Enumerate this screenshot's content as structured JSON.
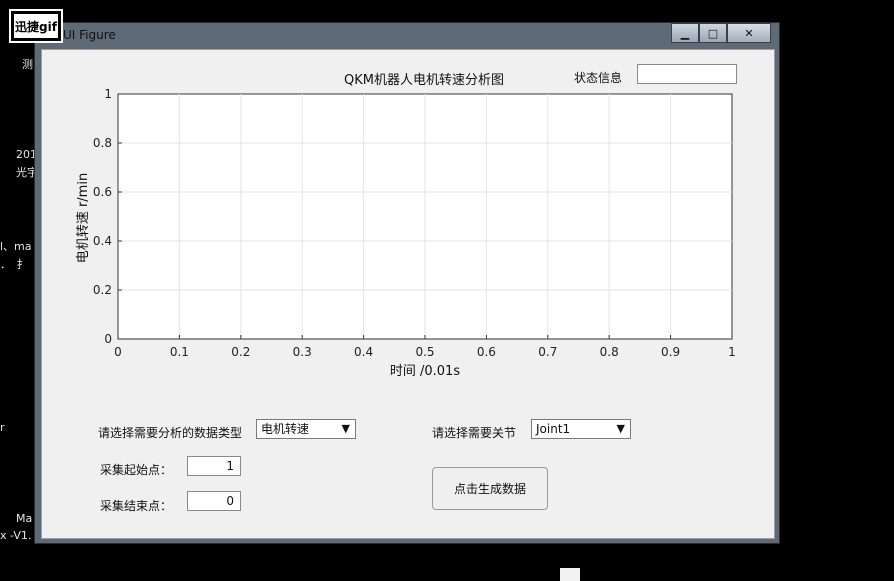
{
  "desktop": {
    "badge": "迅捷gif",
    "fragments": [
      "测",
      "201",
      "光宇",
      "l、ma",
      "．　扌",
      "r",
      "Ma",
      "x  -V1."
    ]
  },
  "window": {
    "title": "UI Figure",
    "controls": {
      "minimize": "▁",
      "maximize": "□",
      "close": "✕"
    }
  },
  "status": {
    "label": "状态信息",
    "value": ""
  },
  "chart_data": {
    "type": "line",
    "title": "QKM机器人电机转速分析图",
    "xlabel": "时间 /0.01s",
    "ylabel": "电机转速 r/min",
    "xlim": [
      0,
      1
    ],
    "ylim": [
      0,
      1
    ],
    "xticks": [
      "0",
      "0.1",
      "0.2",
      "0.3",
      "0.4",
      "0.5",
      "0.6",
      "0.7",
      "0.8",
      "0.9",
      "1"
    ],
    "yticks": [
      "0",
      "0.2",
      "0.4",
      "0.6",
      "0.8",
      "1"
    ],
    "grid": true,
    "series": []
  },
  "form": {
    "data_type_label": "请选择需要分析的数据类型",
    "data_type_value": "电机转速",
    "joint_label": "请选择需要关节",
    "joint_value": "Joint1",
    "start_label": "采集起始点：",
    "start_value": "1",
    "end_label": "采集结束点：",
    "end_value": "0",
    "generate_button": "点击生成数据"
  }
}
